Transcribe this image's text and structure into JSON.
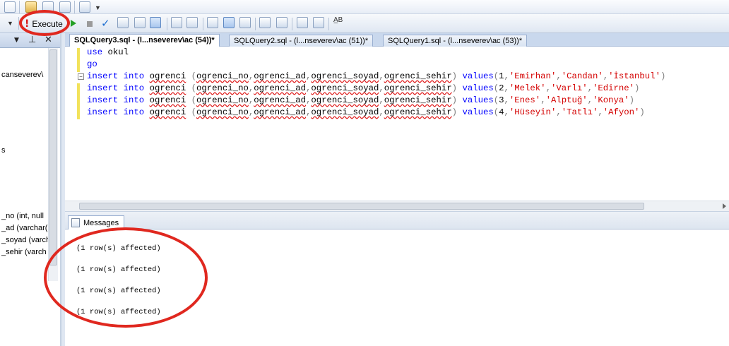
{
  "toolbar": {
    "execute_label": "Execute",
    "execute_icon": "!",
    "check_glyph": "✓",
    "ab_glyph": "A̲B"
  },
  "left_panel": {
    "pin_glyph": "⊥",
    "close_glyph": "✕",
    "dropdown_glyph": "▼",
    "items": [
      "canseverev\\",
      "s",
      "_no (int, null",
      "_ad (varchar(",
      "_soyad (varch",
      "_sehir (varch"
    ]
  },
  "tabs": [
    {
      "label": "SQLQuery3.sql - (l...nseverev\\ac (54))*",
      "active": true
    },
    {
      "label": "SQLQuery2.sql - (l...nseverev\\ac (51))*",
      "active": false
    },
    {
      "label": "SQLQuery1.sql - (l...nseverev\\ac (53))*",
      "active": false
    }
  ],
  "editor": {
    "collapse_glyph": "−",
    "lines": [
      {
        "kw": "use",
        "rest": " okul"
      },
      {
        "kw": "go",
        "rest": ""
      },
      {
        "kw1": "insert",
        "kw2": "into",
        "table": "ogrenci",
        "cols": [
          "ogrenci_no",
          "ogrenci_ad",
          "ogrenci_soyad",
          "ogrenci_sehir"
        ],
        "values_kw": "values",
        "num": "1",
        "strs": [
          "'Emirhan'",
          "'Candan'",
          "'İstanbul'"
        ]
      },
      {
        "kw1": "insert",
        "kw2": "into",
        "table": "ogrenci",
        "cols": [
          "ogrenci_no",
          "ogrenci_ad",
          "ogrenci_soyad",
          "ogrenci_sehir"
        ],
        "values_kw": "values",
        "num": "2",
        "strs": [
          "'Melek'",
          "'Varlı'",
          "'Edirne'"
        ]
      },
      {
        "kw1": "insert",
        "kw2": "into",
        "table": "ogrenci",
        "cols": [
          "ogrenci_no",
          "ogrenci_ad",
          "ogrenci_soyad",
          "ogrenci_sehir"
        ],
        "values_kw": "values",
        "num": "3",
        "strs": [
          "'Enes'",
          "'Alptuğ'",
          "'Konya'"
        ]
      },
      {
        "kw1": "insert",
        "kw2": "into",
        "table": "ogrenci",
        "cols": [
          "ogrenci_no",
          "ogrenci_ad",
          "ogrenci_soyad",
          "ogrenci_sehir"
        ],
        "values_kw": "values",
        "num": "4",
        "strs": [
          "'Hüseyin'",
          "'Tatlı'",
          "'Afyon'"
        ]
      }
    ]
  },
  "results": {
    "tab_label": "Messages",
    "messages": [
      "(1 row(s) affected)",
      "(1 row(s) affected)",
      "(1 row(s) affected)",
      "(1 row(s) affected)"
    ]
  },
  "colors": {
    "keyword": "#0000ff",
    "string": "#d40000",
    "annotation_ring": "#e0281f",
    "modified_bar": "#f2e25b"
  }
}
